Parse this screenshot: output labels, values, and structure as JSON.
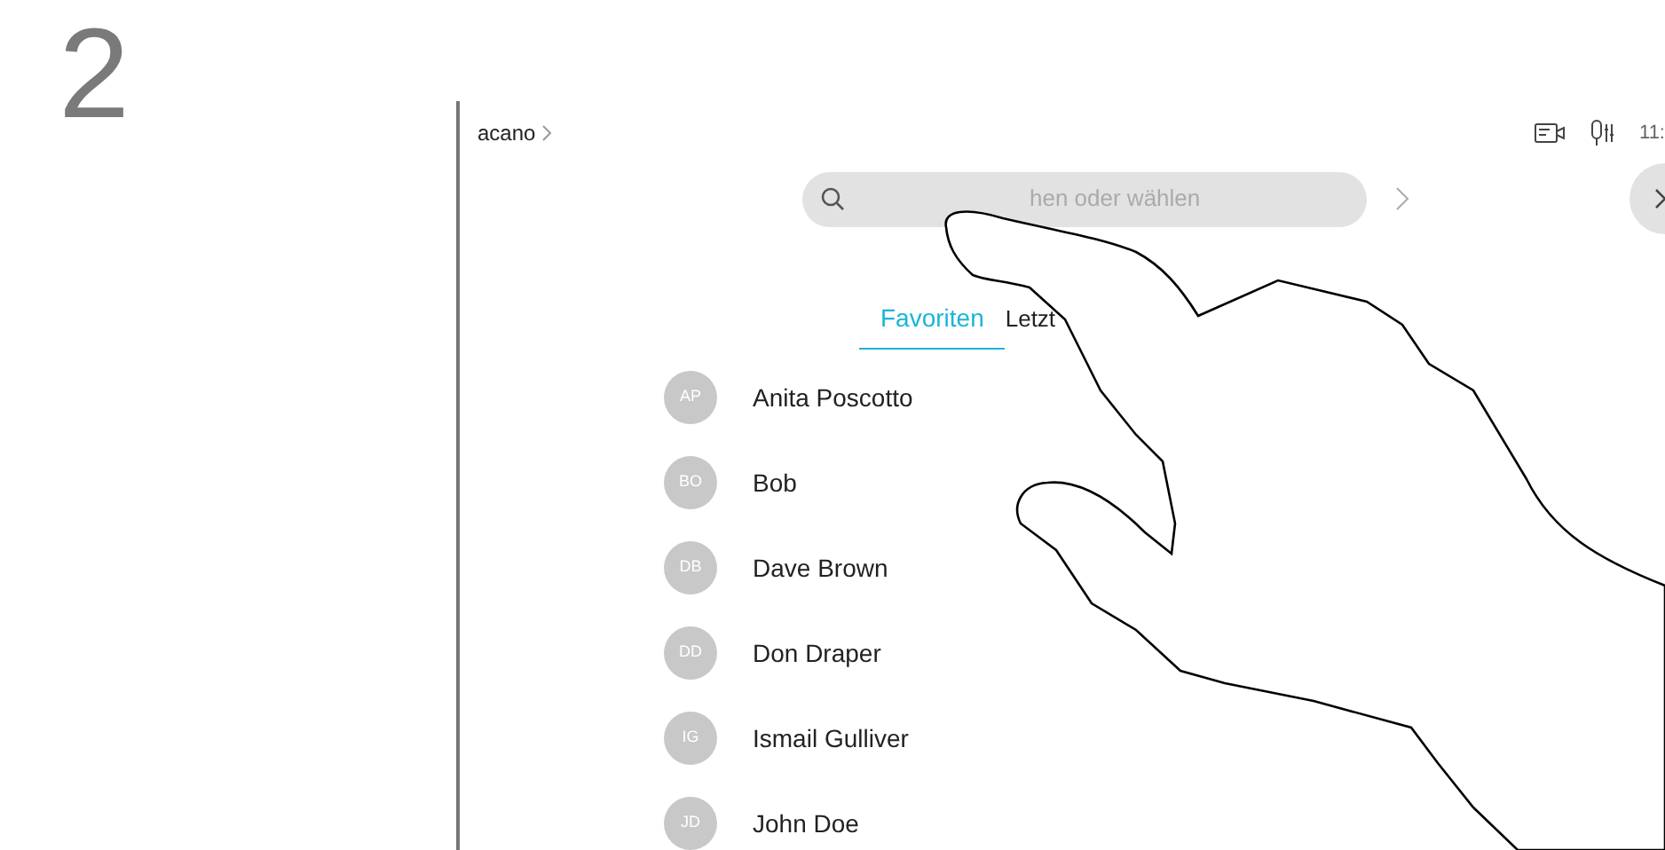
{
  "step_number": "2",
  "screen": {
    "breadcrumb": "acano",
    "time": "11:",
    "search": {
      "placeholder": "hen oder wählen"
    },
    "tabs": [
      {
        "label": "Favoriten",
        "selected": true
      },
      {
        "label": "Letzt",
        "selected": false
      }
    ],
    "contacts": [
      {
        "initials": "AP",
        "name": "Anita Poscotto"
      },
      {
        "initials": "BO",
        "name": "Bob"
      },
      {
        "initials": "DB",
        "name": "Dave Brown"
      },
      {
        "initials": "DD",
        "name": "Don Draper"
      },
      {
        "initials": "IG",
        "name": "Ismail Gulliver"
      },
      {
        "initials": "JD",
        "name": "John Doe"
      }
    ]
  }
}
